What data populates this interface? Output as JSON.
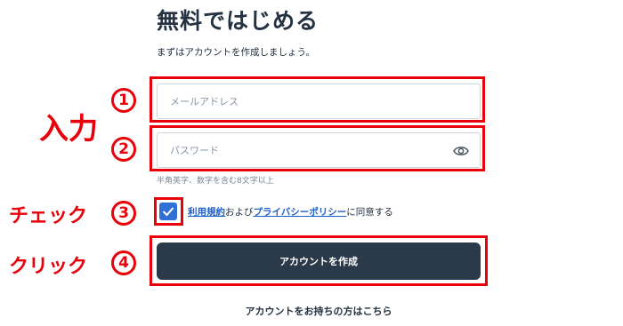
{
  "page": {
    "title": "無料ではじめる",
    "subtitle": "まずはアカウントを作成しましょう。"
  },
  "form": {
    "email_placeholder": "メールアドレス",
    "password_placeholder": "パスワード",
    "password_hint": "半角英字、数字を含む8文字以上",
    "agree_terms_link": "利用規約",
    "agree_and": "および",
    "agree_privacy_link": "プライバシーポリシー",
    "agree_suffix": "に同意する",
    "terms_checked": true,
    "submit_label": "アカウントを作成",
    "login_link": "アカウントをお持ちの方はこちら"
  },
  "annotations": {
    "input_label": "入力",
    "check_label": "チェック",
    "click_label": "クリック",
    "step1": "1",
    "step2": "2",
    "step3": "3",
    "step4": "4",
    "color": "#e8000b"
  },
  "colors": {
    "primary": "#2b3a4a",
    "link": "#1e5fc8",
    "checkbox": "#2f6fd6"
  },
  "icons": {
    "password_toggle": "eye-icon",
    "checkbox_mark": "checkmark-icon"
  }
}
